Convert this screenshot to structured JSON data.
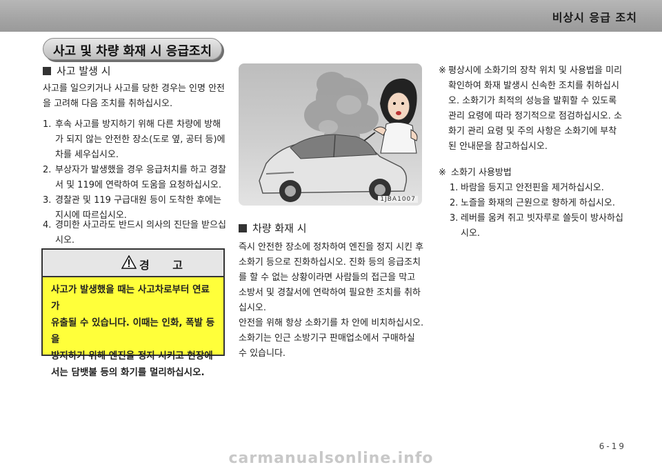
{
  "header": {
    "title": "비상시 응급 조치"
  },
  "banner": {
    "title": "사고 및 차량 화재 시 응급조치"
  },
  "accident": {
    "heading": "사고 발생 시",
    "intro": [
      "사고를 일으키거나 사고를 당한 경우는 인명 안전",
      "을 고려해 다음 조치를 취하십시오."
    ],
    "items": [
      {
        "num": "1.",
        "lines": [
          "후속 사고를 방지하기 위해 다른 차량에 방해",
          "가 되지 않는 안전한 장소(도로 옆, 공터 등)에",
          "차를 세우십시오."
        ]
      },
      {
        "num": "2.",
        "lines": [
          "부상자가 발생했을 경우 응급처치를 하고 경찰",
          "서 및 119에 연락하여 도움을 요청하십시오."
        ]
      },
      {
        "num": "3.",
        "lines": [
          "경찰관 및 119 구급대원 등이 도착한 후에는",
          "지시에 따르십시오."
        ]
      },
      {
        "num": "4.",
        "lines": [
          "경미한 사고라도 반드시 의사의 진단을 받으십",
          "시오."
        ]
      }
    ]
  },
  "warning": {
    "title": "경 고",
    "body": [
      "사고가 발생했을 때는 사고차로부터 연료가",
      "유출될 수 있습니다. 이때는 인화, 폭발 등을",
      "방지하기 위해 엔진을 정지 시키고 현장에",
      "서는 담뱃불 등의 화기를 멀리하십시오."
    ]
  },
  "illustration": {
    "code": "1JBA1007"
  },
  "fire": {
    "heading": "차량 화재 시",
    "lines": [
      "즉시 안전한 장소에 정차하여 엔진을 정지 시킨 후",
      "소화기 등으로 진화하십시오. 진화 등의 응급조치",
      "를 할 수 없는 상황이라면 사람들의 접근을 막고",
      "소방서 및 경찰서에 연락하여 필요한 조치를 취하",
      "십시오.",
      "안전을 위해 항상 소화기를 차 안에 비치하십시오.",
      "소화기는 인근 소방기구 판매업소에서 구매하실",
      "수 있습니다."
    ]
  },
  "note1": {
    "mark": "※",
    "lines": [
      "평상시에 소화기의 장착 위치 및 사용법을 미리",
      "확인하여 화재 발생시 신속한 조치를 취하십시",
      "오. 소화기가 최적의 성능을 발휘할 수 있도록",
      "관리 요령에 따라 정기적으로 점검하십시오. 소",
      "화기 관리 요령 및 주의 사항은 소화기에 부착",
      "된 안내문을 참고하십시오."
    ]
  },
  "note2": {
    "mark": "※",
    "heading": "소화기 사용방법",
    "items": [
      {
        "num": "1.",
        "lines": [
          "바람을 등지고 안전핀을 제거하십시오."
        ]
      },
      {
        "num": "2.",
        "lines": [
          "노즐을 화재의 근원으로 향하게 하십시오."
        ]
      },
      {
        "num": "3.",
        "lines": [
          "레버를 움켜 쥐고 빗자루로 쓸듯이 방사하십",
          "시오."
        ]
      }
    ]
  },
  "page": {
    "number": "6-19"
  },
  "watermark": {
    "text": "carmanualsonline.info"
  }
}
